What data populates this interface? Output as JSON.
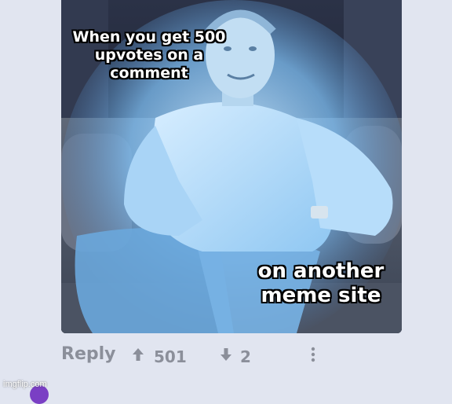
{
  "meme": {
    "caption_top": "When you get 500 upvotes on a comment",
    "caption_bottom": "on another meme site"
  },
  "actions": {
    "reply_label": "Reply",
    "upvote_count": "501",
    "downvote_count": "2",
    "upvote_icon": "arrow-up-icon",
    "downvote_icon": "arrow-down-icon",
    "more_icon": "more-vertical-icon"
  },
  "watermark": {
    "text": "imgflip.com"
  },
  "colors": {
    "background": "#e1e5f0",
    "action_text": "#8b8f9a",
    "glow": "#9fd3ff"
  }
}
